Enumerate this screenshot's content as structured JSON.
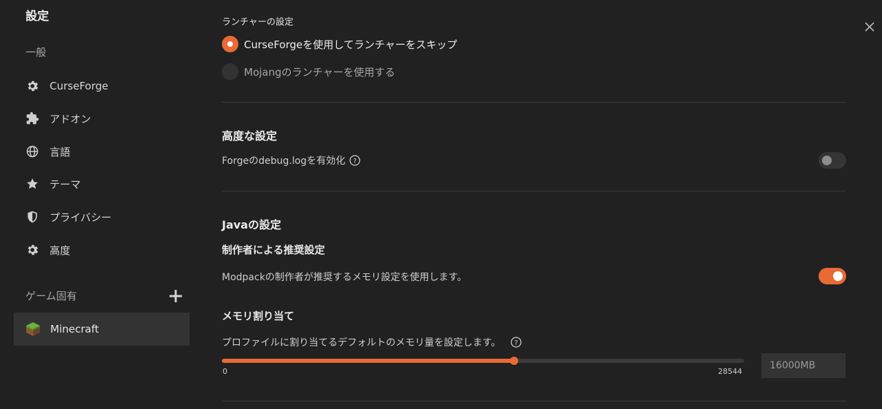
{
  "sidebar": {
    "title": "設定",
    "general_section": "一般",
    "items": [
      {
        "label": "CurseForge",
        "icon": "gear-icon"
      },
      {
        "label": "アドオン",
        "icon": "puzzle-icon"
      },
      {
        "label": "言語",
        "icon": "globe-icon"
      },
      {
        "label": "テーマ",
        "icon": "star-icon"
      },
      {
        "label": "プライバシー",
        "icon": "shield-icon"
      },
      {
        "label": "高度",
        "icon": "gear-icon"
      }
    ],
    "game_section": "ゲーム固有",
    "game_item": {
      "label": "Minecraft",
      "icon": "minecraft-block-icon"
    }
  },
  "launcher": {
    "title": "ランチャーの設定",
    "options": [
      {
        "label": "CurseForgeを使用してランチャーをスキップ",
        "selected": true
      },
      {
        "label": "Mojangのランチャーを使用する",
        "selected": false
      }
    ]
  },
  "advanced": {
    "title": "高度な設定",
    "debug_label": "Forgeのdebug.logを有効化",
    "debug_enabled": false
  },
  "java": {
    "title": "Javaの設定",
    "recommended_title": "制作者による推奨設定",
    "recommended_desc": "Modpackの制作者が推奨するメモリ設定を使用します。",
    "recommended_enabled": true,
    "memory_title": "メモリ割り当て",
    "memory_desc": "プロファイルに割り当てるデフォルトのメモリ量を設定します。",
    "slider_min": "0",
    "slider_max": "28544",
    "slider_value_fraction": 0.56,
    "memory_value": "16000MB"
  },
  "colors": {
    "accent": "#e96a35",
    "background": "#212121",
    "sidebar_selected": "#333333"
  }
}
